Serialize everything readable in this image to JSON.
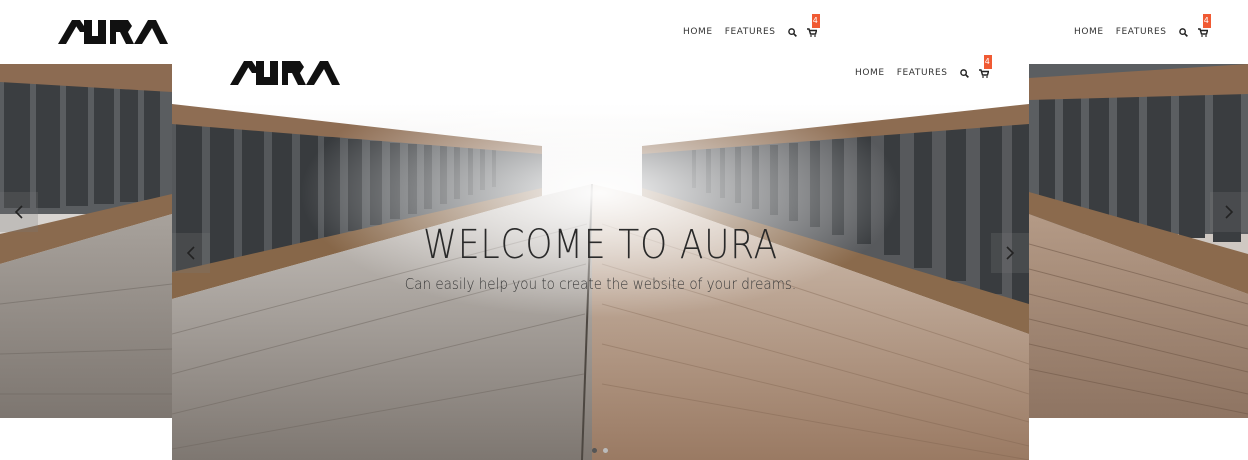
{
  "brand": {
    "logo_text": "AURA"
  },
  "nav": {
    "home": "HOME",
    "features": "FEATURES",
    "search_icon": "search-icon",
    "cart_icon": "cart-icon",
    "cart_count": "4"
  },
  "hero": {
    "title": "WELCOME TO AURA",
    "subtitle": "Can easily help you to create the website of your dreams."
  },
  "colors": {
    "badge": "#f05a33",
    "text": "#2a2a2a"
  }
}
